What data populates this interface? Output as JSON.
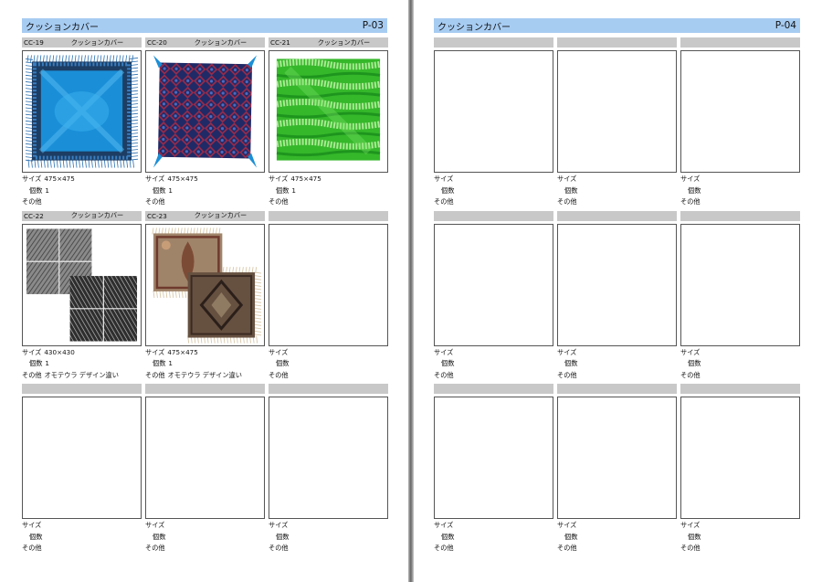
{
  "left_page": {
    "title": "クッションカバー",
    "page_number": "P-03",
    "items": [
      {
        "code": "CC-19",
        "name": "クッションカバー",
        "size_label": "サイズ",
        "size": "475×475",
        "qty_label": "個数",
        "qty": "1",
        "other_label": "その他",
        "other": "",
        "image": "blue-satin-cushion-image"
      },
      {
        "code": "CC-20",
        "name": "クッションカバー",
        "size_label": "サイズ",
        "size": "475×475",
        "qty_label": "個数",
        "qty": "1",
        "other_label": "その他",
        "other": "",
        "image": "navy-damask-cushion-image"
      },
      {
        "code": "CC-21",
        "name": "クッションカバー",
        "size_label": "サイズ",
        "size": "475×475",
        "qty_label": "個数",
        "qty": "1",
        "other_label": "その他",
        "other": "",
        "image": "green-satin-cushion-image"
      },
      {
        "code": "CC-22",
        "name": "クッションカバー",
        "size_label": "サイズ",
        "size": "430×430",
        "qty_label": "個数",
        "qty": "1",
        "other_label": "その他",
        "other": "オモテウラ デザイン違い",
        "image": "grey-striped-cushion-image"
      },
      {
        "code": "CC-23",
        "name": "クッションカバー",
        "size_label": "サイズ",
        "size": "475×475",
        "qty_label": "個数",
        "qty": "1",
        "other_label": "その他",
        "other": "オモテウラ デザイン違い",
        "image": "brown-fringed-cushion-image"
      },
      {
        "code": "",
        "name": "",
        "size_label": "サイズ",
        "size": "",
        "qty_label": "個数",
        "qty": "",
        "other_label": "その他",
        "other": "",
        "image": ""
      },
      {
        "code": "",
        "name": "",
        "size_label": "サイズ",
        "size": "",
        "qty_label": "個数",
        "qty": "",
        "other_label": "その他",
        "other": "",
        "image": ""
      },
      {
        "code": "",
        "name": "",
        "size_label": "サイズ",
        "size": "",
        "qty_label": "個数",
        "qty": "",
        "other_label": "その他",
        "other": "",
        "image": ""
      },
      {
        "code": "",
        "name": "",
        "size_label": "サイズ",
        "size": "",
        "qty_label": "個数",
        "qty": "",
        "other_label": "その他",
        "other": "",
        "image": ""
      }
    ]
  },
  "right_page": {
    "title": "クッションカバー",
    "page_number": "P-04",
    "items": [
      {
        "code": "",
        "name": "",
        "size_label": "サイズ",
        "size": "",
        "qty_label": "個数",
        "qty": "",
        "other_label": "その他",
        "other": ""
      },
      {
        "code": "",
        "name": "",
        "size_label": "サイズ",
        "size": "",
        "qty_label": "個数",
        "qty": "",
        "other_label": "その他",
        "other": ""
      },
      {
        "code": "",
        "name": "",
        "size_label": "サイズ",
        "size": "",
        "qty_label": "個数",
        "qty": "",
        "other_label": "その他",
        "other": ""
      },
      {
        "code": "",
        "name": "",
        "size_label": "サイズ",
        "size": "",
        "qty_label": "個数",
        "qty": "",
        "other_label": "その他",
        "other": ""
      },
      {
        "code": "",
        "name": "",
        "size_label": "サイズ",
        "size": "",
        "qty_label": "個数",
        "qty": "",
        "other_label": "その他",
        "other": ""
      },
      {
        "code": "",
        "name": "",
        "size_label": "サイズ",
        "size": "",
        "qty_label": "個数",
        "qty": "",
        "other_label": "その他",
        "other": ""
      },
      {
        "code": "",
        "name": "",
        "size_label": "サイズ",
        "size": "",
        "qty_label": "個数",
        "qty": "",
        "other_label": "その他",
        "other": ""
      },
      {
        "code": "",
        "name": "",
        "size_label": "サイズ",
        "size": "",
        "qty_label": "個数",
        "qty": "",
        "other_label": "その他",
        "other": ""
      },
      {
        "code": "",
        "name": "",
        "size_label": "サイズ",
        "size": "",
        "qty_label": "個数",
        "qty": "",
        "other_label": "その他",
        "other": ""
      }
    ]
  },
  "colors": {
    "header_band": "#a7ccf2",
    "card_header": "#c8c8c8",
    "background": "#888888"
  }
}
